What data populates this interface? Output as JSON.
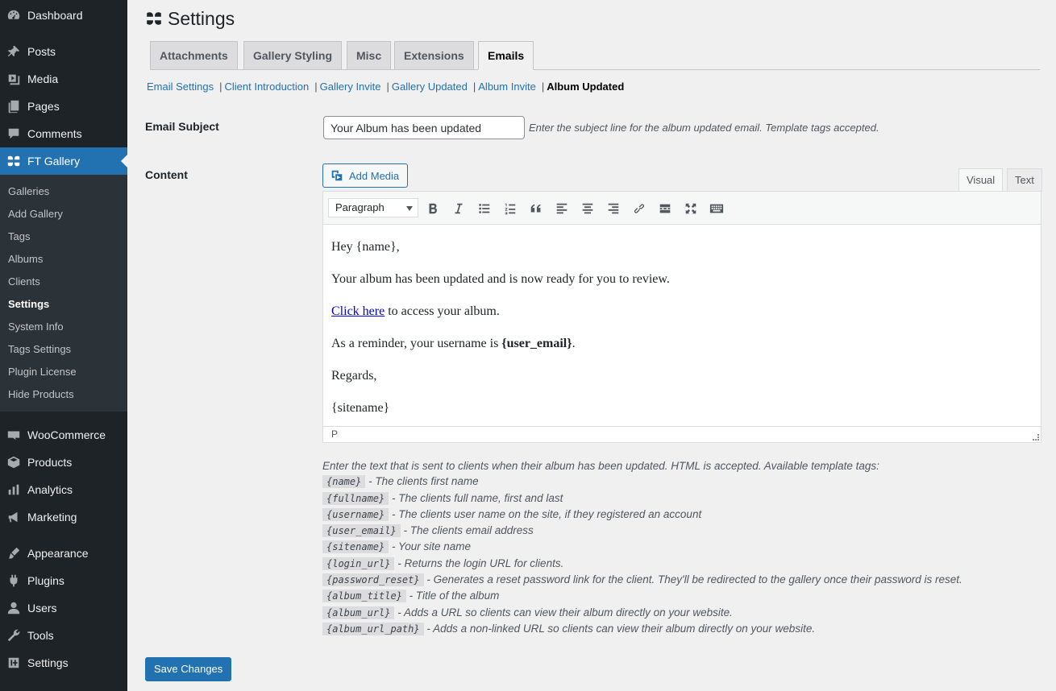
{
  "sidebar": {
    "top_items": [
      {
        "label": "Dashboard",
        "icon": "dashboard-icon"
      },
      {
        "label": "Posts",
        "icon": "pin-icon"
      },
      {
        "label": "Media",
        "icon": "media-icon"
      },
      {
        "label": "Pages",
        "icon": "pages-icon"
      },
      {
        "label": "Comments",
        "icon": "comment-icon"
      },
      {
        "label": "FT Gallery",
        "icon": "ft-gallery-icon"
      }
    ],
    "submenu": [
      "Galleries",
      "Add Gallery",
      "Tags",
      "Albums",
      "Clients",
      "Settings",
      "System Info",
      "Tags Settings",
      "Plugin License",
      "Hide Products"
    ],
    "bottom_items": [
      {
        "label": "WooCommerce",
        "icon": "woo-icon"
      },
      {
        "label": "Products",
        "icon": "products-icon"
      },
      {
        "label": "Analytics",
        "icon": "analytics-icon"
      },
      {
        "label": "Marketing",
        "icon": "megaphone-icon"
      },
      {
        "label": "Appearance",
        "icon": "brush-icon"
      },
      {
        "label": "Plugins",
        "icon": "plug-icon"
      },
      {
        "label": "Users",
        "icon": "user-icon"
      },
      {
        "label": "Tools",
        "icon": "wrench-icon"
      },
      {
        "label": "Settings",
        "icon": "settings-icon"
      }
    ]
  },
  "page": {
    "title": "Settings",
    "tabs": [
      "Attachments",
      "Gallery Styling",
      "Misc",
      "Extensions",
      "Emails"
    ],
    "active_tab": "Emails",
    "subnav": [
      "Email Settings",
      "Client Introduction",
      "Gallery Invite",
      "Gallery Updated",
      "Album Invite",
      "Album Updated"
    ],
    "active_subnav": "Album Updated"
  },
  "form": {
    "subject_label": "Email Subject",
    "subject_value": "Your Album has been updated",
    "subject_desc": "Enter the subject line for the album updated email. Template tags accepted.",
    "content_label": "Content",
    "add_media": "Add Media",
    "visual_tab": "Visual",
    "text_tab": "Text",
    "format_value": "Paragraph",
    "status_path": "P"
  },
  "editor_content": {
    "p1": "Hey {name},",
    "p2": "Your album has been updated and is now ready for you to review.",
    "p3_link": "Click here",
    "p3_rest": " to access your album.",
    "p4_pre": "As a reminder, your username is ",
    "p4_bold": "{user_email}",
    "p4_post": ".",
    "p5": "Regards,",
    "p6": "{sitename}"
  },
  "help": {
    "intro": "Enter the text that is sent to clients when their album has been updated. HTML is accepted. Available template tags:",
    "tags": [
      {
        "tag": "{name}",
        "desc": " - The clients first name"
      },
      {
        "tag": "{fullname}",
        "desc": " - The clients full name, first and last"
      },
      {
        "tag": "{username}",
        "desc": " - The clients user name on the site, if they registered an account"
      },
      {
        "tag": "{user_email}",
        "desc": " - The clients email address"
      },
      {
        "tag": "{sitename}",
        "desc": " - Your site name"
      },
      {
        "tag": "{login_url}",
        "desc": " - Returns the login URL for clients."
      },
      {
        "tag": "{password_reset}",
        "desc": " - Generates a reset password link for the client. They'll be redirected to the gallery once their password is reset."
      },
      {
        "tag": "{album_title}",
        "desc": " - Title of the album"
      },
      {
        "tag": "{album_url}",
        "desc": " - Adds a URL so clients can view their album directly on your website."
      },
      {
        "tag": "{album_url_path}",
        "desc": " - Adds a non-linked URL so clients can view their album directly on your website."
      }
    ]
  },
  "save_label": "Save Changes",
  "colors": {
    "accent": "#2271b1",
    "sidebar": "#1d2327",
    "submenu": "#2c3338"
  }
}
